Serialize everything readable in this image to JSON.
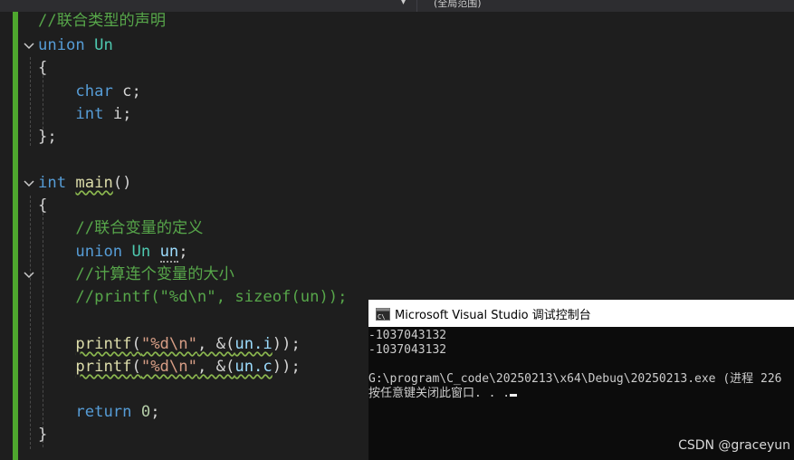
{
  "toolbar": {
    "dropdown_arrow": "▾",
    "scope": "(全局范围)"
  },
  "code": {
    "comment_union_decl": "//联合类型的声明",
    "kw_union": "union",
    "type_un": "Un",
    "brace_open": "{",
    "kw_char": "char",
    "member_c": "c",
    "kw_int": "int",
    "member_i": "i",
    "semicolon": ";",
    "brace_close_semi": "};",
    "brace_close": "}",
    "fn_main": "main",
    "parens": "()",
    "comment_union_var": "//联合变量的定义",
    "var_un": "un",
    "comment_size": "//计算连个变量的大小",
    "comment_printf_sizeof": "//printf(\"%d\\n\", sizeof(un));",
    "fn_printf": "printf",
    "str_format": "\"%d\\n\"",
    "arg_addr_i_prefix": ", &(",
    "arg_i_member": "un.i",
    "arg_c_member": "un.c",
    "call_end": "));",
    "kw_return": "return",
    "zero": "0"
  },
  "console": {
    "title": "Microsoft Visual Studio 调试控制台",
    "lines": [
      "-1037043132",
      "-1037043132",
      "",
      "G:\\program\\C_code\\20250213\\x64\\Debug\\20250213.exe (进程 226",
      "按任意键关闭此窗口. . ."
    ]
  },
  "watermark": "CSDN @graceyun",
  "colors": {
    "editor_bg": "#1e1e1e",
    "keyword": "#569cd6",
    "type": "#4ec9b0",
    "function": "#dcdcaa",
    "comment": "#57a64a",
    "string": "#d69d85",
    "number": "#b5cea8",
    "change_bar": "#4ea72e",
    "console_bg": "#0c0c0c"
  }
}
